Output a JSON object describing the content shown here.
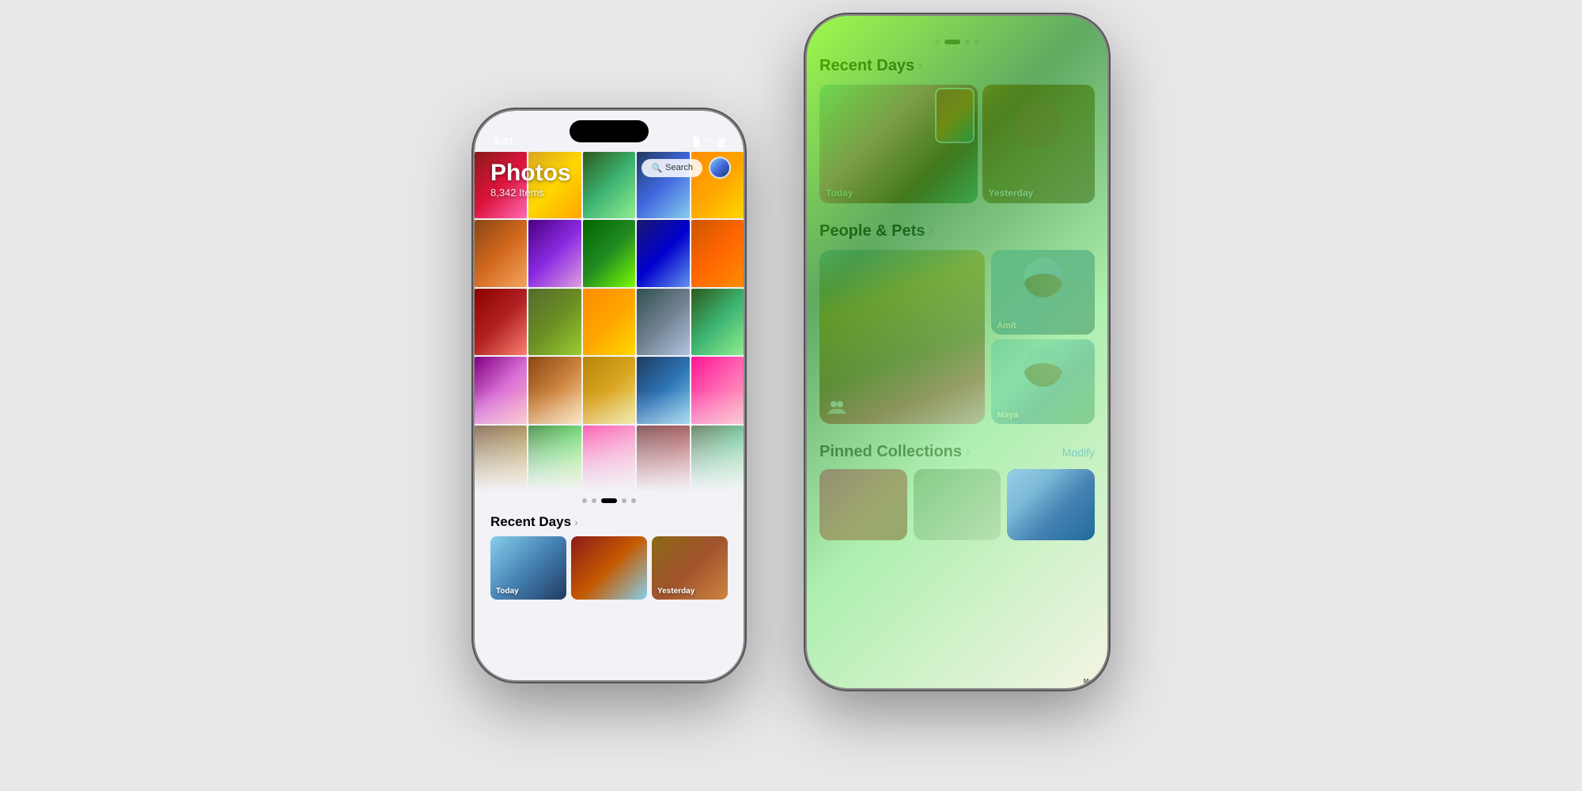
{
  "scene": {
    "background": "#e8e8ea"
  },
  "left_phone": {
    "status_bar": {
      "time": "9:41",
      "signal_icon": "signal",
      "wifi_icon": "wifi",
      "battery_icon": "battery"
    },
    "header": {
      "title": "Photos",
      "item_count": "8,342 Items",
      "search_placeholder": "Search"
    },
    "page_dots": [
      "dot",
      "dot",
      "dot-active",
      "dot",
      "dot"
    ],
    "bottom_section": {
      "recent_days_label": "Recent Days",
      "chevron": "›"
    }
  },
  "right_phone": {
    "top_dots": [
      "dot",
      "dot-active-grid",
      "dot",
      "dot"
    ],
    "sections": {
      "recent_days": {
        "title": "Recent Days",
        "chevron": "›",
        "cards": [
          {
            "label": "Today"
          },
          {
            "label": "Yesterday"
          }
        ]
      },
      "people_pets": {
        "title": "People & Pets",
        "chevron": "›",
        "people": [
          {
            "name": "Amit"
          },
          {
            "name": "Maya"
          }
        ]
      },
      "pinned_collections": {
        "title": "Pinned Collections",
        "chevron": "›",
        "modify_label": "Modify"
      }
    }
  }
}
